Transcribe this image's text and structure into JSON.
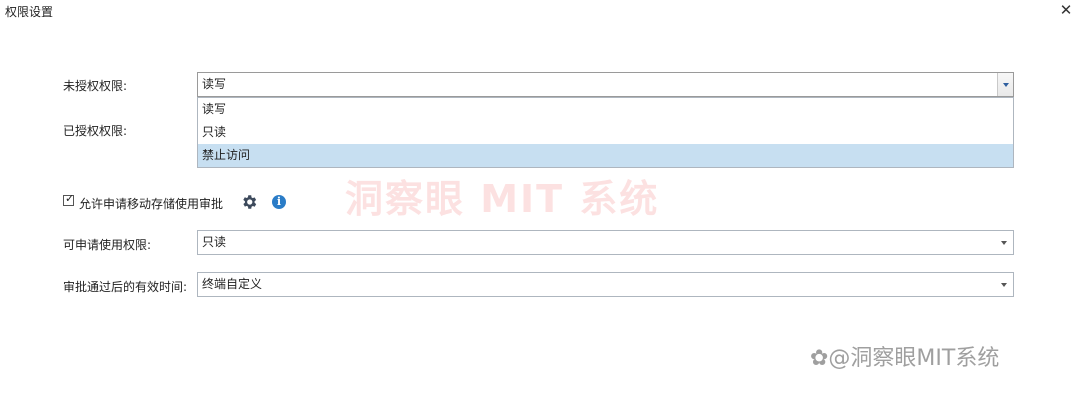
{
  "window": {
    "title": "权限设置",
    "close_symbol": "✕"
  },
  "fields": {
    "unauthorized": {
      "label": "未授权权限:",
      "value": "读写"
    },
    "authorized": {
      "label": "已授权权限:"
    },
    "allow_request": {
      "label": "允许申请移动存储使用审批",
      "checked": true
    },
    "requestable": {
      "label": "可申请使用权限:",
      "value": "只读"
    },
    "valid_time": {
      "label": "审批通过后的有效时间:",
      "value": "终端自定义"
    }
  },
  "dropdown": {
    "options": [
      "读写",
      "只读",
      "禁止访问"
    ],
    "highlighted_index": 2
  },
  "icons": {
    "settings": "gear-icon",
    "info": "info-icon",
    "info_glyph": "i"
  },
  "watermarks": {
    "center": "洞察眼 MIT 系统",
    "corner": "✿@洞察眼MIT系统"
  },
  "colors": {
    "highlight": "#c7dff1",
    "info": "#2a7cc7",
    "border": "#aeb6bf"
  }
}
